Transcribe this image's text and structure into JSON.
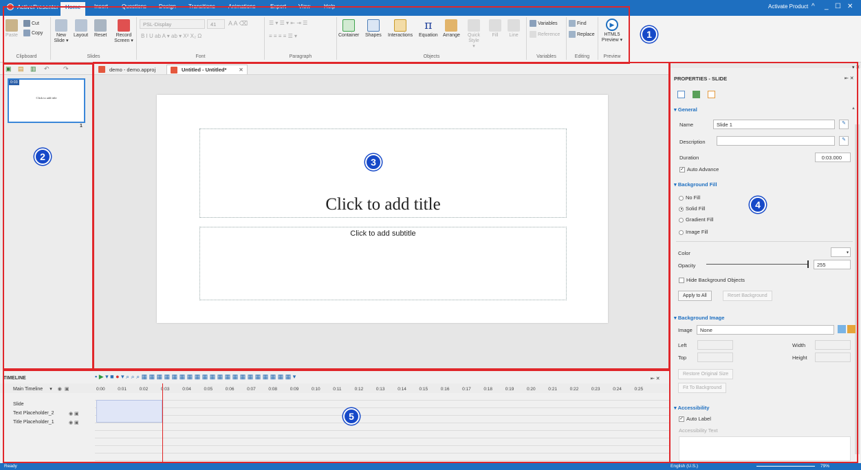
{
  "app": {
    "name": "ActivePresenter",
    "activate": "Activate Product",
    "window_controls": [
      "^",
      "_",
      "☐",
      "✕"
    ]
  },
  "menu_tabs": [
    "Home",
    "Insert",
    "Questions",
    "Design",
    "Transitions",
    "Animations",
    "Export",
    "View",
    "Help"
  ],
  "ribbon": {
    "clipboard": {
      "paste": "Paste",
      "cut": "Cut",
      "copy": "Copy",
      "label": "Clipboard"
    },
    "slides": {
      "new_slide": "New Slide ▾",
      "layout": "Layout",
      "reset": "Reset",
      "label": "Slides"
    },
    "record": {
      "label": "Record Screen ▾"
    },
    "font": {
      "family": "PSL-Display",
      "size": "41",
      "label": "Font"
    },
    "paragraph": {
      "label": "Paragraph"
    },
    "objects": {
      "items": [
        "Container",
        "Shapes",
        "Interactions",
        "Equation",
        "Arrange",
        "Quick Style ▾",
        "Fill",
        "Line"
      ],
      "label": "Objects"
    },
    "variables": {
      "variables": "Variables",
      "reference": "Reference",
      "label": "Variables"
    },
    "editing": {
      "find": "Find",
      "replace": "Replace",
      "label": "Editing"
    },
    "preview": {
      "html5": "HTML5 Preview ▾",
      "label": "Preview"
    }
  },
  "doc_tabs": [
    {
      "label": "demo - demo.approj",
      "active": false
    },
    {
      "label": "Untitled - Untitled*",
      "active": true
    }
  ],
  "slide_panel": {
    "thumb_time": "0:03",
    "thumb_text": "Click to add title",
    "slide_number": "1"
  },
  "slide": {
    "title": "Click to add title",
    "subtitle": "Click to add subtitle"
  },
  "markers": [
    "1",
    "2",
    "3",
    "4",
    "5"
  ],
  "properties": {
    "header": "PROPERTIES - SLIDE",
    "general": {
      "section": "General",
      "name_label": "Name",
      "name": "Slide 1",
      "desc_label": "Description",
      "description": "",
      "duration_label": "Duration",
      "duration": "0:03.000",
      "auto_advance": "Auto Advance"
    },
    "background_fill": {
      "section": "Background Fill",
      "options": [
        "No Fill",
        "Solid Fill",
        "Gradient Fill",
        "Image Fill"
      ],
      "selected": "Solid Fill",
      "color_label": "Color",
      "opacity_label": "Opacity",
      "opacity": "255",
      "opacity_fraction": 1,
      "hide_bg": "Hide Background Objects",
      "apply_all": "Apply to All",
      "reset_bg": "Reset Background"
    },
    "background_image": {
      "section": "Background Image",
      "image_label": "Image",
      "image": "None",
      "left": "Left",
      "top": "Top",
      "width": "Width",
      "height": "Height",
      "restore": "Restore Original Size",
      "fit": "Fit To Background"
    },
    "accessibility": {
      "section": "Accessibility",
      "auto_label": "Auto Label",
      "text_label": "Accessibility Text"
    }
  },
  "timeline": {
    "header": "TIMELINE",
    "main": "Main Timeline",
    "rows": [
      "Slide",
      "Text Placeholder_2",
      "Title Placeholder_1"
    ],
    "ticks": [
      "0:00",
      "0:01",
      "0:02",
      "0:03",
      "0:04",
      "0:05",
      "0:06",
      "0:07",
      "0:08",
      "0:09",
      "0:10",
      "0:11",
      "0:12",
      "0:13",
      "0:14",
      "0:15",
      "0:16",
      "0:17",
      "0:18",
      "0:19",
      "0:20",
      "0:21",
      "0:22",
      "0:23",
      "0:24",
      "0:25"
    ]
  },
  "status": {
    "left": "Ready",
    "lang": "English (U.S.)",
    "zoom": "79%"
  }
}
